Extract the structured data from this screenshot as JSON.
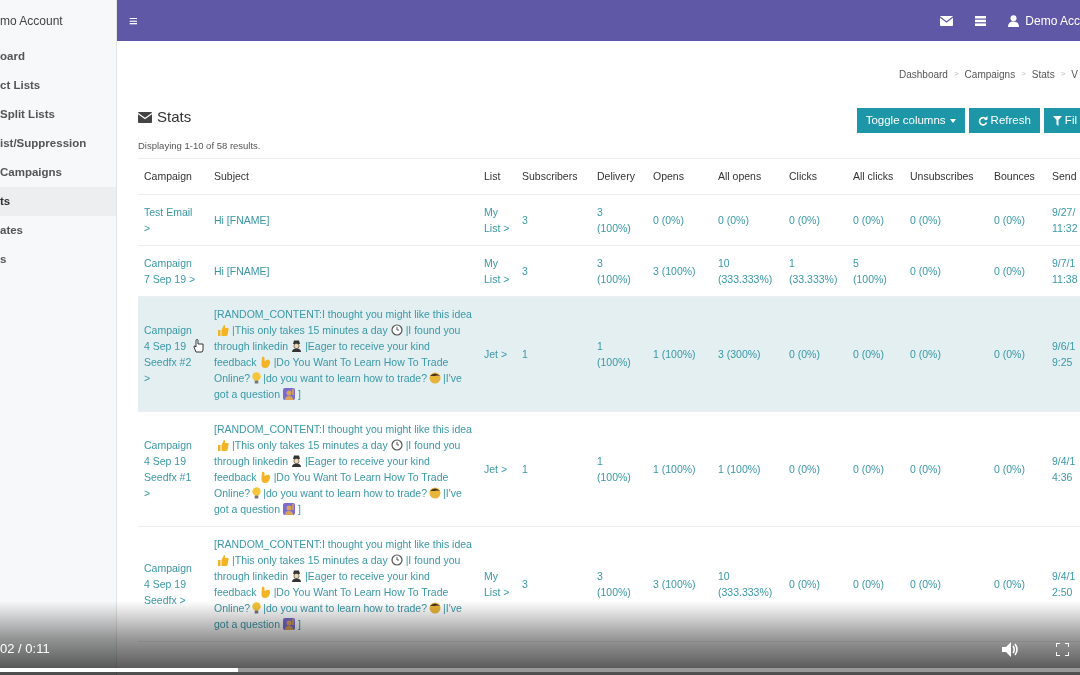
{
  "sidebar": {
    "account": "mo Account",
    "items": [
      {
        "label": "oard",
        "selected": false
      },
      {
        "label": "ct Lists",
        "selected": false
      },
      {
        "label": "Split Lists",
        "selected": false
      },
      {
        "label": "ist/Suppression",
        "selected": false
      },
      {
        "label": "Campaigns",
        "selected": false
      },
      {
        "label": "ts",
        "selected": true
      },
      {
        "label": "ates",
        "selected": false
      },
      {
        "label": "s",
        "selected": false
      }
    ]
  },
  "topbar": {
    "menu_icon": "≡",
    "user": "Demo Acc"
  },
  "breadcrumb": {
    "separator": ">",
    "items": [
      "Dashboard",
      "Campaigns",
      "Stats",
      "V"
    ]
  },
  "page_title": "Stats",
  "buttons": [
    {
      "label": "Toggle columns",
      "kind": "dropdown"
    },
    {
      "label": "Refresh",
      "kind": "refresh"
    },
    {
      "label": "Fil",
      "kind": "filter"
    }
  ],
  "summary": "Displaying 1-10 of 58 results.",
  "table": {
    "columns": [
      "Campaign",
      "Subject",
      "List",
      "Subscribers",
      "Delivery",
      "Opens",
      "All opens",
      "Clicks",
      "All clicks",
      "Unsubscribes",
      "Bounces",
      "Send"
    ],
    "rows": [
      {
        "highlighted": false,
        "campaign": "Test Email >",
        "subject": [
          "Hi [FNAME]"
        ],
        "list": "My List >",
        "values": [
          "3",
          "3 (100%)",
          "0 (0%)",
          "0 (0%)",
          "0 (0%)",
          "0 (0%)",
          "0 (0%)",
          "0 (0%)",
          "9/27/ 11:32"
        ]
      },
      {
        "highlighted": false,
        "campaign": "Campaign 7 Sep 19 >",
        "subject": [
          "Hi [FNAME]"
        ],
        "list": "My List >",
        "values": [
          "3",
          "3 (100%)",
          "3 (100%)",
          "10 (333.333%)",
          "1 (33.333%)",
          "5 (100%)",
          "0 (0%)",
          "0 (0%)",
          "9/7/1 11:38"
        ]
      },
      {
        "highlighted": true,
        "campaign": "Campaign 4 Sep 19 Seedfx #2 >",
        "subject": [
          "[RANDOM_CONTENT:I thought you might like this idea",
          "|This only takes 15 minutes a day",
          "|I found you through linkedin",
          "|Eager to receive your kind feedback",
          "|Do You Want To Learn How To Trade Online?",
          "|do you want to learn how to trade?",
          "|I've got a question",
          "]"
        ],
        "list": "Jet >",
        "values": [
          "1",
          "1 (100%)",
          "1 (100%)",
          "3 (300%)",
          "0 (0%)",
          "0 (0%)",
          "0 (0%)",
          "0 (0%)",
          "9/6/1 9:25"
        ]
      },
      {
        "highlighted": false,
        "campaign": "Campaign 4 Sep 19 Seedfx #1 >",
        "subject": [
          "[RANDOM_CONTENT:I thought you might like this idea",
          "|This only takes 15 minutes a day",
          "|I found you through linkedin",
          "|Eager to receive your kind feedback",
          "|Do You Want To Learn How To Trade Online?",
          "|do you want to learn how to trade?",
          "|I've got a question",
          "]"
        ],
        "list": "Jet >",
        "values": [
          "1",
          "1 (100%)",
          "1 (100%)",
          "1 (100%)",
          "0 (0%)",
          "0 (0%)",
          "0 (0%)",
          "0 (0%)",
          "9/4/1 4:36"
        ]
      },
      {
        "highlighted": false,
        "campaign": "Campaign 4 Sep 19 Seedfx >",
        "subject": [
          "[RANDOM_CONTENT:I thought you might like this idea",
          "|This only takes 15 minutes a day",
          "|I found you through linkedin",
          "|Eager to receive your kind feedback",
          "|Do You Want To Learn How To Trade Online?",
          "|do you want to learn how to trade?",
          "|I've got a question",
          "]"
        ],
        "list": "My List >",
        "values": [
          "3",
          "3 (100%)",
          "3 (100%)",
          "10 (333.333%)",
          "0 (0%)",
          "0 (0%)",
          "0 (0%)",
          "0 (0%)",
          "9/4/1 2:50"
        ]
      }
    ]
  },
  "video_player": {
    "time": "02 / 0:11",
    "level": 0.22
  }
}
